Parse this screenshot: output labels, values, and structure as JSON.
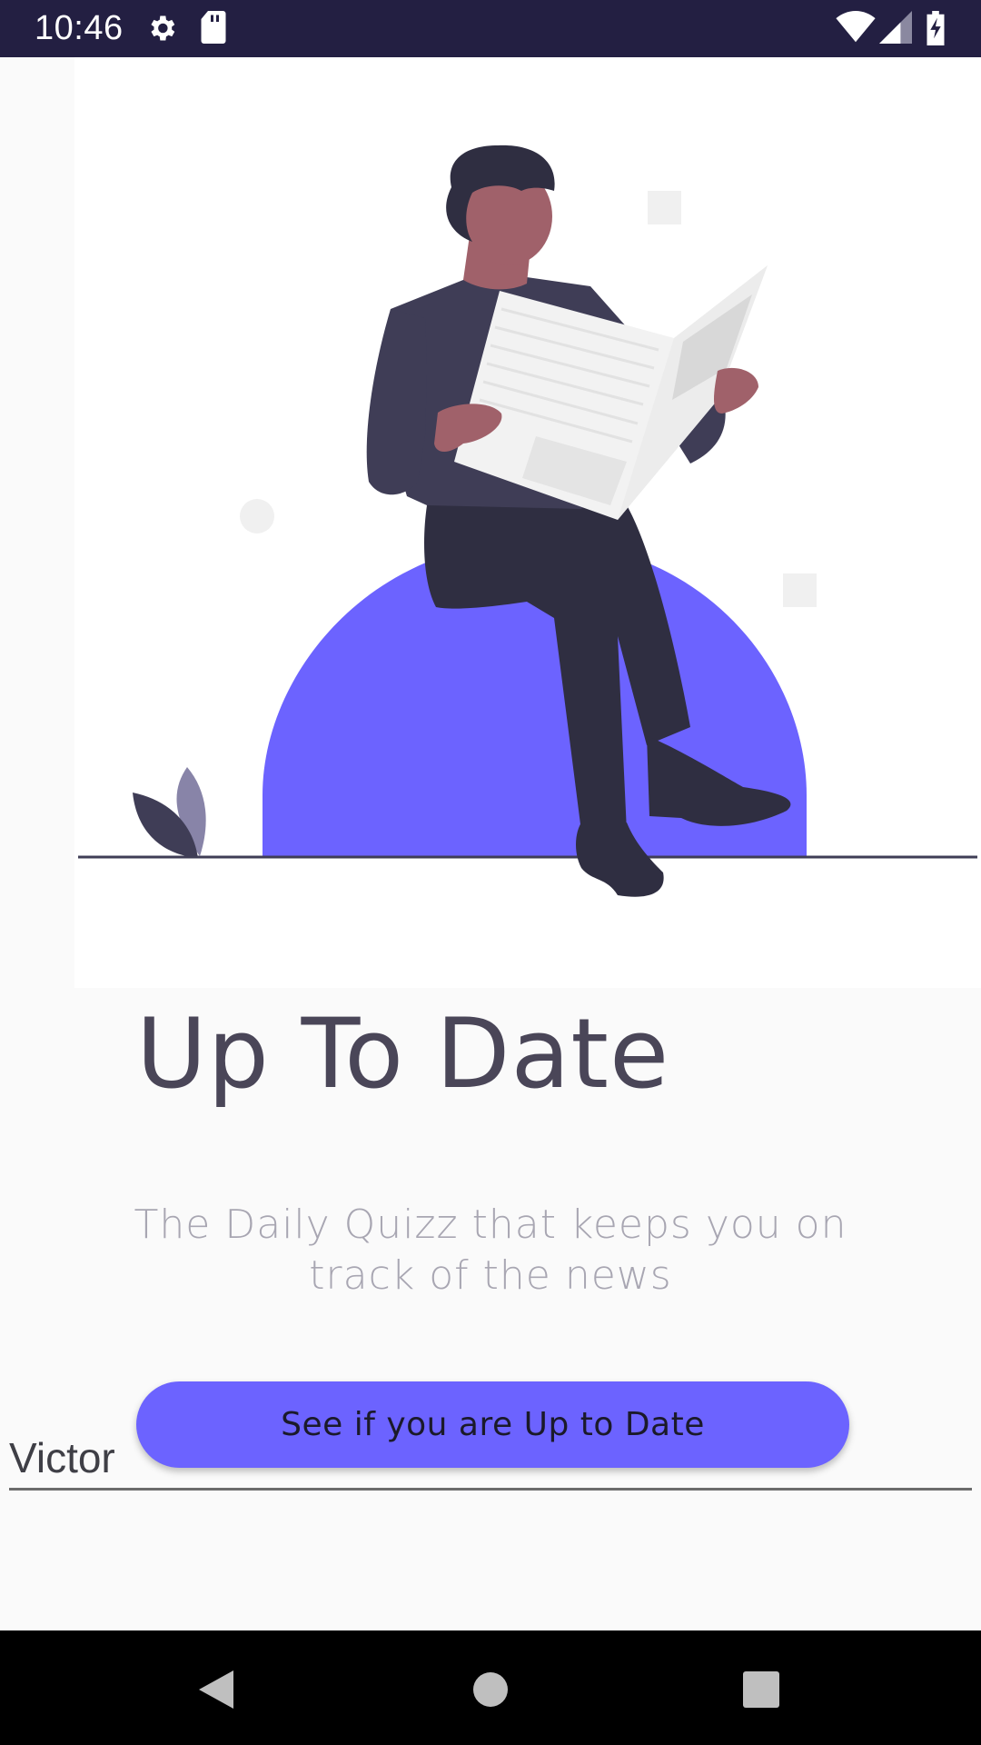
{
  "status_bar": {
    "time": "10:46",
    "icons": [
      "gear-icon",
      "sd-card-icon",
      "wifi-icon",
      "signal-icon",
      "battery-charging-icon"
    ]
  },
  "illustration": {
    "name": "man-reading-newspaper-illustration",
    "colors": {
      "accent": "#6c63ff",
      "dark": "#2f2e41",
      "skin": "#a0616a",
      "paper": "#f2f2f2"
    }
  },
  "main": {
    "title": "Up To Date",
    "subtitle": "The Daily Quizz that keeps you on track of the news",
    "name_value": "Victor",
    "cta_label": "See if you are Up to Date"
  },
  "nav_bar": {
    "buttons": [
      "back-icon",
      "home-icon",
      "recents-icon"
    ]
  },
  "colors": {
    "status_bar": "#231f42",
    "button": "#6c63ff",
    "background": "#fafafa"
  }
}
